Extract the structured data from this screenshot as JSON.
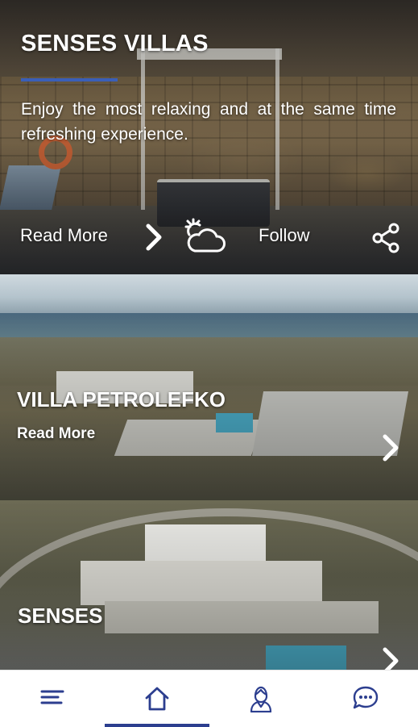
{
  "hero": {
    "title": "SENSES VILLAS",
    "description": "Enjoy the most relaxing and at the same time refreshing experience.",
    "read_more_label": "Read More",
    "follow_label": "Follow",
    "icons": [
      "chevron-right-icon",
      "partly-cloudy-weather-icon",
      "share-icon"
    ]
  },
  "cards": [
    {
      "title": "VILLA PETROLEFKO",
      "read_more_label": "Read More",
      "icon": "chevron-right-icon"
    },
    {
      "title": "SENSES",
      "icon": "chevron-right-icon"
    }
  ],
  "bottom_nav": {
    "items": [
      {
        "name": "menu",
        "icon": "hamburger-menu-icon"
      },
      {
        "name": "home",
        "icon": "home-icon",
        "active": true
      },
      {
        "name": "profile",
        "icon": "concierge-person-icon"
      },
      {
        "name": "chat",
        "icon": "chat-bubble-icon"
      }
    ],
    "accent_color": "#2c3e8f"
  },
  "colors": {
    "title_underline": "#3a5fb8",
    "nav_icon": "#2c3e8f",
    "text_on_image": "#ffffff"
  }
}
